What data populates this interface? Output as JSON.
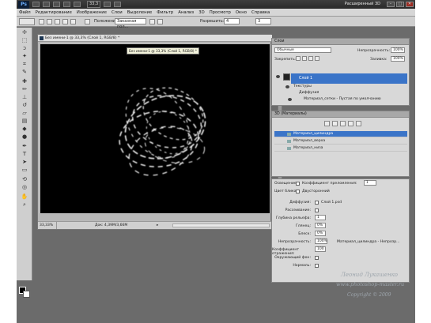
{
  "app": {
    "logo": "Ps",
    "zoom_pct": "33,3",
    "workspace": "Расширенный 3D",
    "win_buttons": [
      "–",
      "□",
      "✕"
    ]
  },
  "menu": [
    "Файл",
    "Редактирование",
    "Изображение",
    "Слои",
    "Выделение",
    "Фильтр",
    "Анализ",
    "3D",
    "Просмотр",
    "Окно",
    "Справка"
  ],
  "options": {
    "label1": "Положение:",
    "field1": "Заказная пол...",
    "label2": "Разрешить:",
    "field2": "4",
    "field3": "3"
  },
  "document": {
    "tab_title": "Без имени-1 @ 33,3% (Слой 1, RGB/8) *",
    "tooltip": "Без имени-1 @ 33,3% (Слой 1, RGB/8) *",
    "zoom": "33,33%",
    "info": "Док: 4,39M/3,66M"
  },
  "layers_panel": {
    "tab": "Слои",
    "blend_mode": "Обычные",
    "opacity_label": "Непрозрачность:",
    "opacity_value": "100%",
    "lock_label": "Закрепить:",
    "fill_label": "Заливка:",
    "fill_value": "100%",
    "layer_name": "Слой 1",
    "sub1": "Текстуры",
    "sub2": "Диффузия",
    "sub3": "Материал_сетки - Пустая по умолчанию"
  },
  "panel3d": {
    "tab": "3D (Материалы)",
    "materials": [
      "Материал_цилиндра",
      "Материал_верха",
      "Материал_низа"
    ]
  },
  "props": {
    "env_label": "Освещение",
    "coef_label": "Коэффициент преломления:",
    "coef_value": "1",
    "two_sided_label": "Двусторонний",
    "light_label": "Цвет блика",
    "rows": [
      "Диффузия:",
      "Рассеивание:",
      "Глубина рельефа:",
      "Глянец:",
      "Блеск:",
      "Непрозрачность:",
      "Коэффициент отражения:",
      "Окружающий фон:",
      "Нормаль:"
    ],
    "values": [
      "",
      "",
      "1",
      "0%",
      "0%",
      "100%",
      "100",
      "",
      ""
    ],
    "diffuse_map": "Слой 1.psd",
    "opacity_map": "Материал_цилиндра - Непрозр..."
  },
  "credit": {
    "author": "Леонид Лукашенко",
    "url": "www.photoshop-master.ru",
    "copyright": "Copyright © 2009"
  },
  "colors": {
    "canvas": "#000000",
    "chrome": "#cfcfcf",
    "selection": "#3a74c8",
    "workspace_bg": "#6b6b6b"
  }
}
